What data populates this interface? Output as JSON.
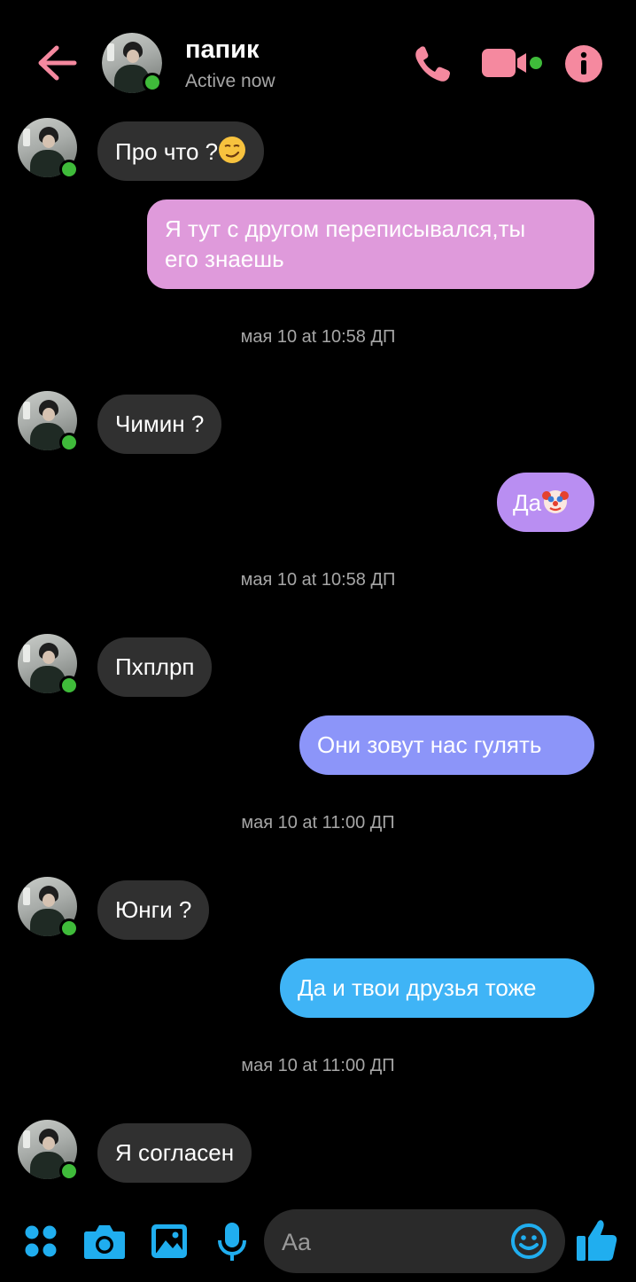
{
  "header": {
    "contact_name": "папик",
    "status": "Active now",
    "icons": [
      "back-arrow-icon",
      "phone-icon",
      "video-camera-icon",
      "info-icon"
    ]
  },
  "messages": [
    {
      "direction": "in",
      "text": "Про что ?",
      "emoji": "smirking-face"
    },
    {
      "direction": "out",
      "text_line1": "Я тут с другом переписывался,ты",
      "text_line2": "его знаешь"
    },
    {
      "type": "timestamp",
      "text": "мая 10 at 10:58 ДП"
    },
    {
      "direction": "in",
      "text": "Чимин ?"
    },
    {
      "direction": "out",
      "text": "Да",
      "emoji": "clown-face"
    },
    {
      "type": "timestamp",
      "text": "мая 10 at 10:58 ДП"
    },
    {
      "direction": "in",
      "text": "Пхплрп"
    },
    {
      "direction": "out",
      "text": "Они зовут нас гулять"
    },
    {
      "type": "timestamp",
      "text": "мая 10 at 11:00 ДП"
    },
    {
      "direction": "in",
      "text": "Юнги ?"
    },
    {
      "direction": "out",
      "text": "Да и твои друзья тоже"
    },
    {
      "type": "timestamp",
      "text": "мая 10 at 11:00 ДП"
    },
    {
      "direction": "in",
      "text": "Я согласен"
    }
  ],
  "composer": {
    "placeholder": "Aa",
    "icons": [
      "apps-grid-icon",
      "camera-icon",
      "gallery-icon",
      "microphone-icon",
      "emoji-icon",
      "thumbs-up-icon"
    ]
  },
  "colors": {
    "accent_pink": "#f5899f",
    "bubble_pink": "#df9adb",
    "bubble_purple": "#b98ef2",
    "bubble_blue_violet": "#8c95f9",
    "bubble_blue": "#3fb4f6",
    "composer_blue": "#20aeef",
    "incoming_bubble": "#303030",
    "online_green": "#3fbb3a"
  }
}
